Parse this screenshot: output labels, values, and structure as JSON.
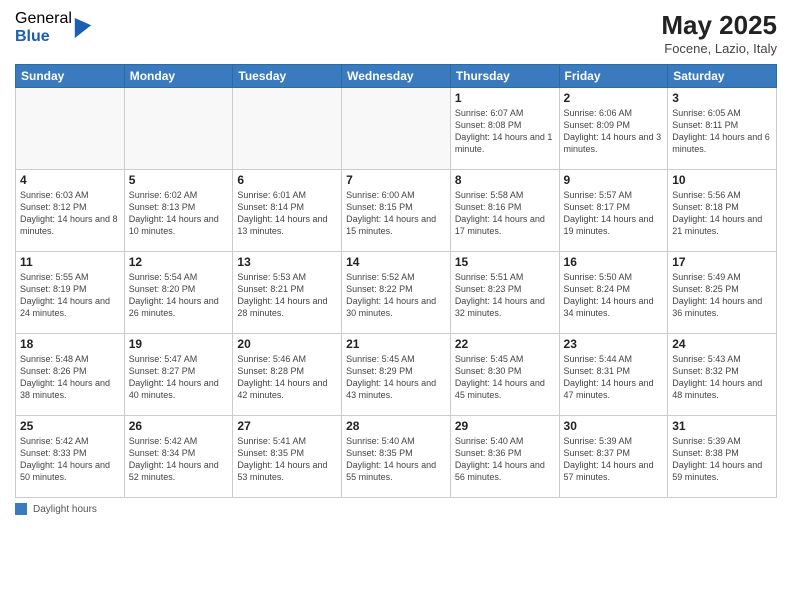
{
  "logo": {
    "general": "General",
    "blue": "Blue"
  },
  "title": {
    "month_year": "May 2025",
    "location": "Focene, Lazio, Italy"
  },
  "days_of_week": [
    "Sunday",
    "Monday",
    "Tuesday",
    "Wednesday",
    "Thursday",
    "Friday",
    "Saturday"
  ],
  "legend": {
    "label": "Daylight hours"
  },
  "weeks": [
    {
      "days": [
        {
          "num": "",
          "info": ""
        },
        {
          "num": "",
          "info": ""
        },
        {
          "num": "",
          "info": ""
        },
        {
          "num": "",
          "info": ""
        },
        {
          "num": "1",
          "info": "Sunrise: 6:07 AM\nSunset: 8:08 PM\nDaylight: 14 hours and 1 minute."
        },
        {
          "num": "2",
          "info": "Sunrise: 6:06 AM\nSunset: 8:09 PM\nDaylight: 14 hours and 3 minutes."
        },
        {
          "num": "3",
          "info": "Sunrise: 6:05 AM\nSunset: 8:11 PM\nDaylight: 14 hours and 6 minutes."
        }
      ]
    },
    {
      "days": [
        {
          "num": "4",
          "info": "Sunrise: 6:03 AM\nSunset: 8:12 PM\nDaylight: 14 hours and 8 minutes."
        },
        {
          "num": "5",
          "info": "Sunrise: 6:02 AM\nSunset: 8:13 PM\nDaylight: 14 hours and 10 minutes."
        },
        {
          "num": "6",
          "info": "Sunrise: 6:01 AM\nSunset: 8:14 PM\nDaylight: 14 hours and 13 minutes."
        },
        {
          "num": "7",
          "info": "Sunrise: 6:00 AM\nSunset: 8:15 PM\nDaylight: 14 hours and 15 minutes."
        },
        {
          "num": "8",
          "info": "Sunrise: 5:58 AM\nSunset: 8:16 PM\nDaylight: 14 hours and 17 minutes."
        },
        {
          "num": "9",
          "info": "Sunrise: 5:57 AM\nSunset: 8:17 PM\nDaylight: 14 hours and 19 minutes."
        },
        {
          "num": "10",
          "info": "Sunrise: 5:56 AM\nSunset: 8:18 PM\nDaylight: 14 hours and 21 minutes."
        }
      ]
    },
    {
      "days": [
        {
          "num": "11",
          "info": "Sunrise: 5:55 AM\nSunset: 8:19 PM\nDaylight: 14 hours and 24 minutes."
        },
        {
          "num": "12",
          "info": "Sunrise: 5:54 AM\nSunset: 8:20 PM\nDaylight: 14 hours and 26 minutes."
        },
        {
          "num": "13",
          "info": "Sunrise: 5:53 AM\nSunset: 8:21 PM\nDaylight: 14 hours and 28 minutes."
        },
        {
          "num": "14",
          "info": "Sunrise: 5:52 AM\nSunset: 8:22 PM\nDaylight: 14 hours and 30 minutes."
        },
        {
          "num": "15",
          "info": "Sunrise: 5:51 AM\nSunset: 8:23 PM\nDaylight: 14 hours and 32 minutes."
        },
        {
          "num": "16",
          "info": "Sunrise: 5:50 AM\nSunset: 8:24 PM\nDaylight: 14 hours and 34 minutes."
        },
        {
          "num": "17",
          "info": "Sunrise: 5:49 AM\nSunset: 8:25 PM\nDaylight: 14 hours and 36 minutes."
        }
      ]
    },
    {
      "days": [
        {
          "num": "18",
          "info": "Sunrise: 5:48 AM\nSunset: 8:26 PM\nDaylight: 14 hours and 38 minutes."
        },
        {
          "num": "19",
          "info": "Sunrise: 5:47 AM\nSunset: 8:27 PM\nDaylight: 14 hours and 40 minutes."
        },
        {
          "num": "20",
          "info": "Sunrise: 5:46 AM\nSunset: 8:28 PM\nDaylight: 14 hours and 42 minutes."
        },
        {
          "num": "21",
          "info": "Sunrise: 5:45 AM\nSunset: 8:29 PM\nDaylight: 14 hours and 43 minutes."
        },
        {
          "num": "22",
          "info": "Sunrise: 5:45 AM\nSunset: 8:30 PM\nDaylight: 14 hours and 45 minutes."
        },
        {
          "num": "23",
          "info": "Sunrise: 5:44 AM\nSunset: 8:31 PM\nDaylight: 14 hours and 47 minutes."
        },
        {
          "num": "24",
          "info": "Sunrise: 5:43 AM\nSunset: 8:32 PM\nDaylight: 14 hours and 48 minutes."
        }
      ]
    },
    {
      "days": [
        {
          "num": "25",
          "info": "Sunrise: 5:42 AM\nSunset: 8:33 PM\nDaylight: 14 hours and 50 minutes."
        },
        {
          "num": "26",
          "info": "Sunrise: 5:42 AM\nSunset: 8:34 PM\nDaylight: 14 hours and 52 minutes."
        },
        {
          "num": "27",
          "info": "Sunrise: 5:41 AM\nSunset: 8:35 PM\nDaylight: 14 hours and 53 minutes."
        },
        {
          "num": "28",
          "info": "Sunrise: 5:40 AM\nSunset: 8:35 PM\nDaylight: 14 hours and 55 minutes."
        },
        {
          "num": "29",
          "info": "Sunrise: 5:40 AM\nSunset: 8:36 PM\nDaylight: 14 hours and 56 minutes."
        },
        {
          "num": "30",
          "info": "Sunrise: 5:39 AM\nSunset: 8:37 PM\nDaylight: 14 hours and 57 minutes."
        },
        {
          "num": "31",
          "info": "Sunrise: 5:39 AM\nSunset: 8:38 PM\nDaylight: 14 hours and 59 minutes."
        }
      ]
    }
  ]
}
